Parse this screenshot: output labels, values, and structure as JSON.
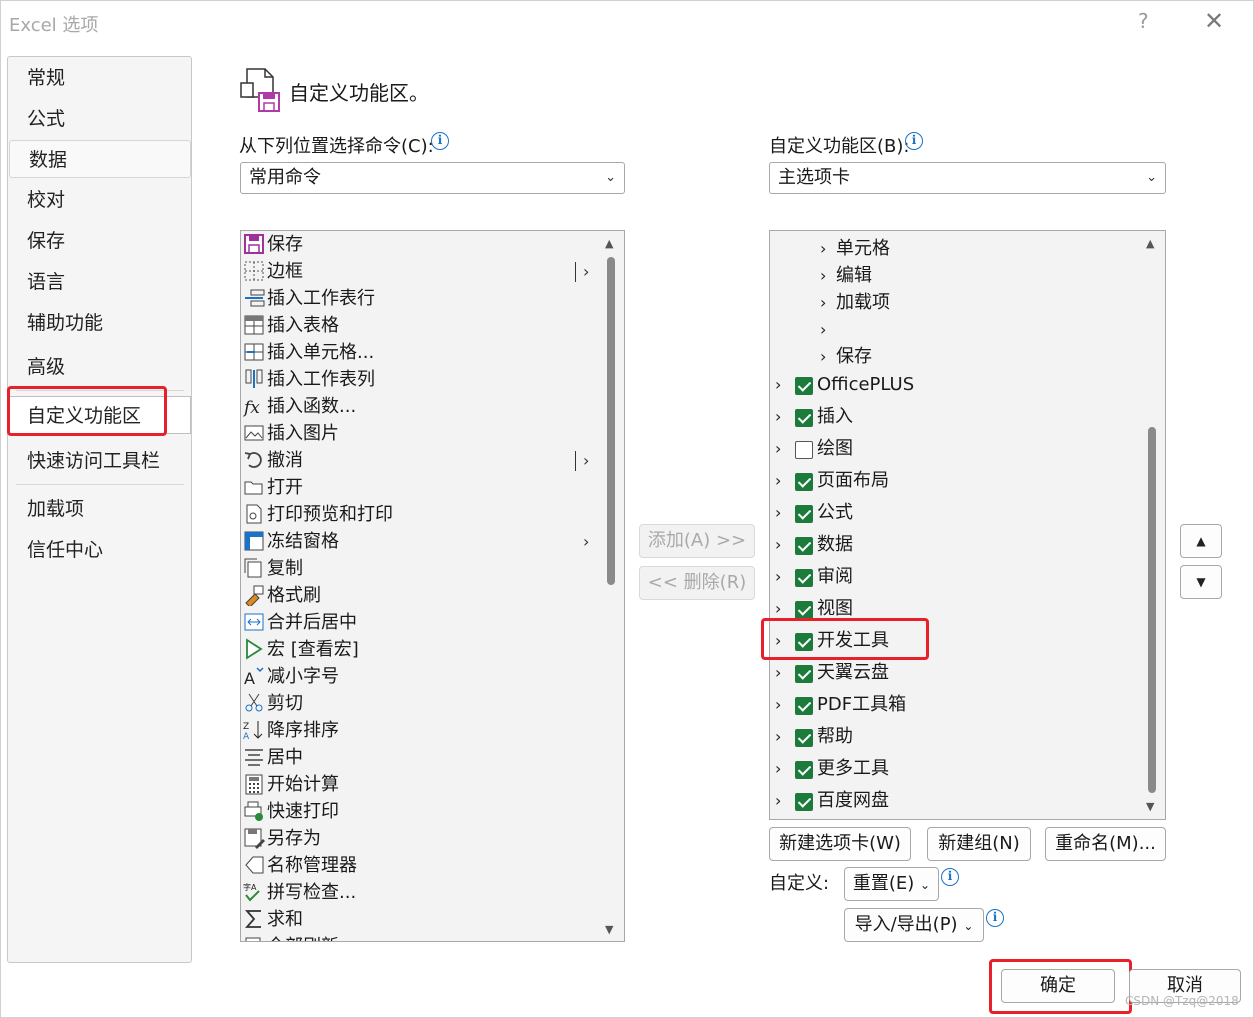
{
  "window": {
    "title": "Excel 选项",
    "help": "?",
    "close": "✕"
  },
  "nav": {
    "items": [
      "常规",
      "公式",
      "数据",
      "校对",
      "保存",
      "语言",
      "辅助功能",
      "高级",
      "自定义功能区",
      "快速访问工具栏",
      "加载项",
      "信任中心"
    ],
    "selected": "自定义功能区"
  },
  "header": {
    "title": "自定义功能区。"
  },
  "left_panel": {
    "label": "从下列位置选择命令(C):",
    "label_key": "C",
    "dropdown_value": "常用命令",
    "commands": [
      {
        "label": "保存",
        "icon": "save-icon"
      },
      {
        "label": "边框",
        "icon": "border-icon",
        "submenu": "split"
      },
      {
        "label": "插入工作表行",
        "icon": "insert-row-icon"
      },
      {
        "label": "插入表格",
        "icon": "table-icon"
      },
      {
        "label": "插入单元格...",
        "icon": "insert-cells-icon"
      },
      {
        "label": "插入工作表列",
        "icon": "insert-column-icon"
      },
      {
        "label": "插入函数...",
        "icon": "function-icon"
      },
      {
        "label": "插入图片",
        "icon": "picture-icon"
      },
      {
        "label": "撤消",
        "icon": "undo-icon",
        "submenu": "split"
      },
      {
        "label": "打开",
        "icon": "open-folder-icon"
      },
      {
        "label": "打印预览和打印",
        "icon": "print-preview-icon"
      },
      {
        "label": "冻结窗格",
        "icon": "freeze-panes-icon",
        "submenu": "arrow"
      },
      {
        "label": "复制",
        "icon": "copy-icon"
      },
      {
        "label": "格式刷",
        "icon": "format-painter-icon"
      },
      {
        "label": "合并后居中",
        "icon": "merge-center-icon"
      },
      {
        "label": "宏 [查看宏]",
        "icon": "macro-icon"
      },
      {
        "label": "减小字号",
        "icon": "decrease-font-icon"
      },
      {
        "label": "剪切",
        "icon": "cut-icon"
      },
      {
        "label": "降序排序",
        "icon": "sort-descending-icon"
      },
      {
        "label": "居中",
        "icon": "align-center-icon"
      },
      {
        "label": "开始计算",
        "icon": "calculator-icon"
      },
      {
        "label": "快速打印",
        "icon": "quick-print-icon"
      },
      {
        "label": "另存为",
        "icon": "save-as-icon"
      },
      {
        "label": "名称管理器",
        "icon": "name-manager-icon"
      },
      {
        "label": "拼写检查...",
        "icon": "spell-check-icon"
      },
      {
        "label": "求和",
        "icon": "sum-icon"
      },
      {
        "label": "全部刷新",
        "icon": "refresh-all-icon"
      }
    ]
  },
  "middle": {
    "add": "添加(A) >>",
    "add_key": "A",
    "remove": "<< 删除(R)",
    "remove_key": "R"
  },
  "right_panel": {
    "label": "自定义功能区(B):",
    "label_key": "B",
    "dropdown_value": "主选项卡",
    "children": [
      "单元格",
      "编辑",
      "加载项",
      "",
      "保存"
    ],
    "tabs": [
      {
        "label": "OfficePLUS",
        "checked": true
      },
      {
        "label": "插入",
        "checked": true
      },
      {
        "label": "绘图",
        "checked": false
      },
      {
        "label": "页面布局",
        "checked": true
      },
      {
        "label": "公式",
        "checked": true
      },
      {
        "label": "数据",
        "checked": true
      },
      {
        "label": "审阅",
        "checked": true
      },
      {
        "label": "视图",
        "checked": true
      },
      {
        "label": "开发工具",
        "checked": true
      },
      {
        "label": "天翼云盘",
        "checked": true
      },
      {
        "label": "PDF工具箱",
        "checked": true
      },
      {
        "label": "帮助",
        "checked": true
      },
      {
        "label": "更多工具",
        "checked": true
      },
      {
        "label": "百度网盘",
        "checked": true
      }
    ],
    "new_tab": "新建选项卡(W)",
    "new_group": "新建组(N)",
    "rename": "重命名(M)...",
    "customize_label": "自定义:",
    "reset": "重置(E)",
    "import_export": "导入/导出(P)"
  },
  "footer": {
    "ok": "确定",
    "cancel": "取消",
    "watermark": "CSDN @Tzq@2018"
  },
  "colors": {
    "highlight": "#e8202a",
    "checkbox": "#1c7b3b",
    "info": "#1a73c8"
  }
}
